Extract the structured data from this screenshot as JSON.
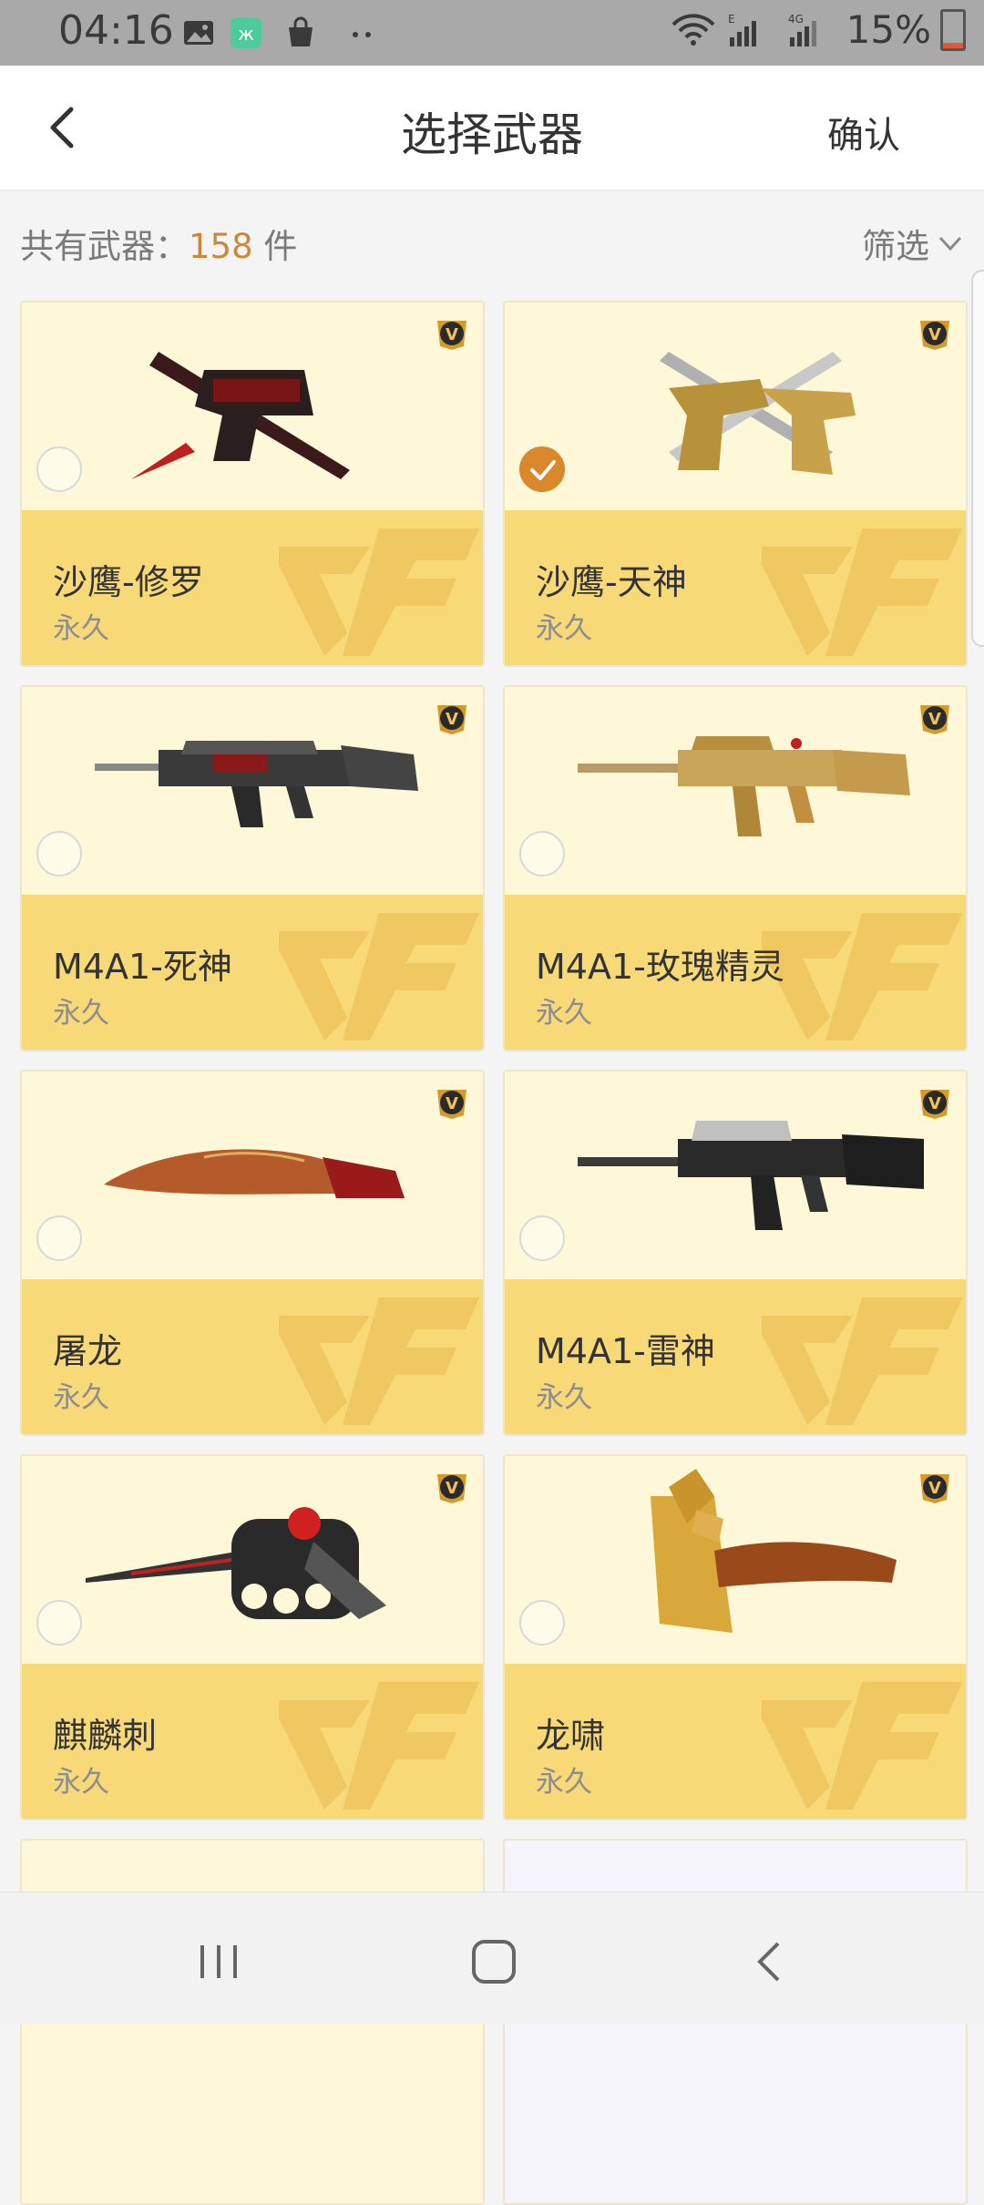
{
  "status_bar": {
    "time": "04:16",
    "battery_percent": "15%",
    "network": "4G",
    "icons": [
      "gallery-icon",
      "app-icon",
      "shopping-bag-icon",
      "more-dots-icon",
      "wifi-icon",
      "signal-icon",
      "battery-icon"
    ]
  },
  "header": {
    "title": "选择武器",
    "confirm_label": "确认",
    "back_icon": "chevron-left-icon"
  },
  "summary": {
    "label": "共有武器：",
    "count": "158",
    "unit": " 件",
    "filter_label": "筛选",
    "filter_icon": "chevron-down-icon"
  },
  "weapons": [
    {
      "name": "沙鹰-修罗",
      "duration": "永久",
      "selected": false,
      "art": "dark-red-pistol-and-blade"
    },
    {
      "name": "沙鹰-天神",
      "duration": "永久",
      "selected": true,
      "art": "gold-silver-pistols-and-blades"
    },
    {
      "name": "M4A1-死神",
      "duration": "永久",
      "selected": false,
      "art": "dark-rifle"
    },
    {
      "name": "M4A1-玫瑰精灵",
      "duration": "永久",
      "selected": false,
      "art": "gold-rifle"
    },
    {
      "name": "屠龙",
      "duration": "永久",
      "selected": false,
      "art": "red-gold-kukri"
    },
    {
      "name": "M4A1-雷神",
      "duration": "永久",
      "selected": false,
      "art": "black-silver-rifle"
    },
    {
      "name": "麒麟刺",
      "duration": "永久",
      "selected": false,
      "art": "knuckle-dagger"
    },
    {
      "name": "龙啸",
      "duration": "永久",
      "selected": false,
      "art": "gold-dragon-axe"
    }
  ],
  "colors": {
    "accent": "#d9892c",
    "card_top": "#fff8d8",
    "card_bottom": "#f8d977",
    "count": "#c9883a"
  }
}
